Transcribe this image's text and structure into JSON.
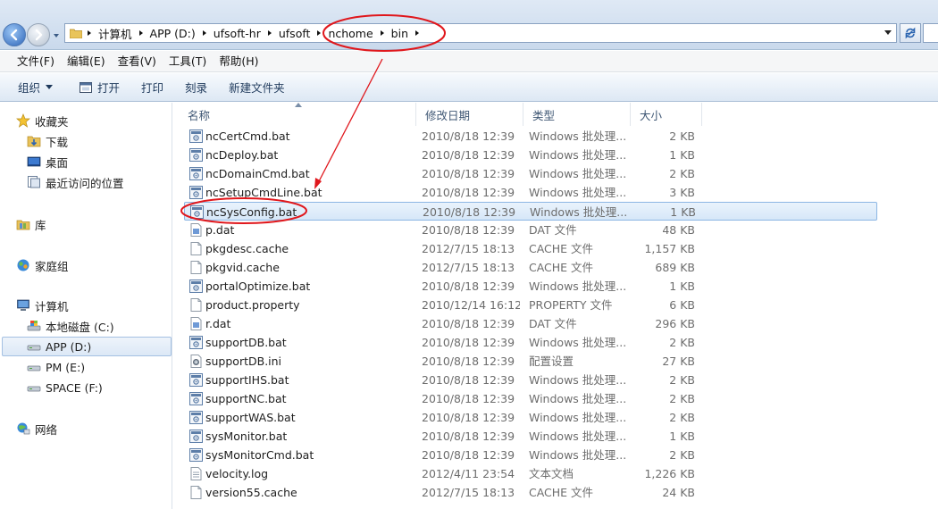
{
  "colors": {
    "annotation_red": "#e0171c",
    "selection_blue": "#8cb6e3",
    "link_text": "#1e395b"
  },
  "address_bar": {
    "crumbs": [
      "计算机",
      "APP (D:)",
      "ufsoft-hr",
      "ufsoft",
      "nchome",
      "bin"
    ]
  },
  "menu": {
    "items": [
      "文件(F)",
      "编辑(E)",
      "查看(V)",
      "工具(T)",
      "帮助(H)"
    ]
  },
  "toolbar": {
    "organize": "组织",
    "open": "打开",
    "print": "打印",
    "burn": "刻录",
    "new_folder": "新建文件夹"
  },
  "nav": {
    "favorites": "收藏夹",
    "downloads": "下载",
    "desktop": "桌面",
    "recent": "最近访问的位置",
    "libraries": "库",
    "homegroup": "家庭组",
    "computer": "计算机",
    "drive_c": "本地磁盘 (C:)",
    "drive_d": "APP (D:)",
    "drive_e": "PM (E:)",
    "drive_f": "SPACE (F:)",
    "network": "网络"
  },
  "columns": {
    "name": "名称",
    "date": "修改日期",
    "type": "类型",
    "size": "大小"
  },
  "files": [
    {
      "name": "ncCertCmd.bat",
      "date": "2010/8/18 12:39",
      "type": "Windows 批处理...",
      "size": "2 KB",
      "icon": "bat-file-icon"
    },
    {
      "name": "ncDeploy.bat",
      "date": "2010/8/18 12:39",
      "type": "Windows 批处理...",
      "size": "1 KB",
      "icon": "bat-file-icon"
    },
    {
      "name": "ncDomainCmd.bat",
      "date": "2010/8/18 12:39",
      "type": "Windows 批处理...",
      "size": "2 KB",
      "icon": "bat-file-icon"
    },
    {
      "name": "ncSetupCmdLine.bat",
      "date": "2010/8/18 12:39",
      "type": "Windows 批处理...",
      "size": "3 KB",
      "icon": "bat-file-icon"
    },
    {
      "name": "ncSysConfig.bat",
      "date": "2010/8/18 12:39",
      "type": "Windows 批处理...",
      "size": "1 KB",
      "icon": "bat-file-icon",
      "selected": true
    },
    {
      "name": "p.dat",
      "date": "2010/8/18 12:39",
      "type": "DAT 文件",
      "size": "48 KB",
      "icon": "dat-file-icon"
    },
    {
      "name": "pkgdesc.cache",
      "date": "2012/7/15 18:13",
      "type": "CACHE 文件",
      "size": "1,157 KB",
      "icon": "blank-file-icon"
    },
    {
      "name": "pkgvid.cache",
      "date": "2012/7/15 18:13",
      "type": "CACHE 文件",
      "size": "689 KB",
      "icon": "blank-file-icon"
    },
    {
      "name": "portalOptimize.bat",
      "date": "2010/8/18 12:39",
      "type": "Windows 批处理...",
      "size": "1 KB",
      "icon": "bat-file-icon"
    },
    {
      "name": "product.property",
      "date": "2010/12/14 16:12",
      "type": "PROPERTY 文件",
      "size": "6 KB",
      "icon": "blank-file-icon"
    },
    {
      "name": "r.dat",
      "date": "2010/8/18 12:39",
      "type": "DAT 文件",
      "size": "296 KB",
      "icon": "dat-file-icon"
    },
    {
      "name": "supportDB.bat",
      "date": "2010/8/18 12:39",
      "type": "Windows 批处理...",
      "size": "2 KB",
      "icon": "bat-file-icon"
    },
    {
      "name": "supportDB.ini",
      "date": "2010/8/18 12:39",
      "type": "配置设置",
      "size": "27 KB",
      "icon": "ini-file-icon"
    },
    {
      "name": "supportIHS.bat",
      "date": "2010/8/18 12:39",
      "type": "Windows 批处理...",
      "size": "2 KB",
      "icon": "bat-file-icon"
    },
    {
      "name": "supportNC.bat",
      "date": "2010/8/18 12:39",
      "type": "Windows 批处理...",
      "size": "2 KB",
      "icon": "bat-file-icon"
    },
    {
      "name": "supportWAS.bat",
      "date": "2010/8/18 12:39",
      "type": "Windows 批处理...",
      "size": "2 KB",
      "icon": "bat-file-icon"
    },
    {
      "name": "sysMonitor.bat",
      "date": "2010/8/18 12:39",
      "type": "Windows 批处理...",
      "size": "1 KB",
      "icon": "bat-file-icon"
    },
    {
      "name": "sysMonitorCmd.bat",
      "date": "2010/8/18 12:39",
      "type": "Windows 批处理...",
      "size": "2 KB",
      "icon": "bat-file-icon"
    },
    {
      "name": "velocity.log",
      "date": "2012/4/11 23:54",
      "type": "文本文档",
      "size": "1,226 KB",
      "icon": "text-file-icon"
    },
    {
      "name": "version55.cache",
      "date": "2012/7/15 18:13",
      "type": "CACHE 文件",
      "size": "24 KB",
      "icon": "blank-file-icon"
    }
  ]
}
